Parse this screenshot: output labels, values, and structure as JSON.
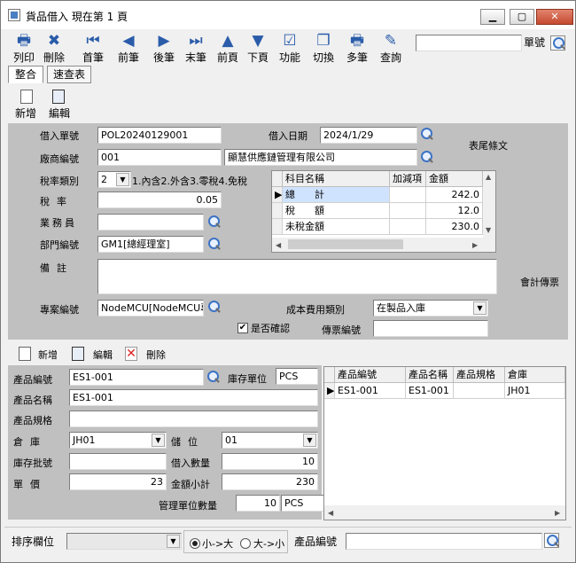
{
  "window": {
    "title": "貨品借入 現在第 1 頁"
  },
  "toolbar": {
    "items": [
      {
        "label": "列印",
        "icon": "printer-icon",
        "glyph": "🖶"
      },
      {
        "label": "刪除",
        "icon": "delete-icon",
        "glyph": "✖"
      },
      {
        "label": "首筆",
        "icon": "first-record-icon",
        "glyph": "⏮"
      },
      {
        "label": "前筆",
        "icon": "prev-record-icon",
        "glyph": "◀"
      },
      {
        "label": "後筆",
        "icon": "next-record-icon",
        "glyph": "▶"
      },
      {
        "label": "末筆",
        "icon": "last-record-icon",
        "glyph": "⏭"
      },
      {
        "label": "前頁",
        "icon": "prev-page-icon",
        "glyph": "▲"
      },
      {
        "label": "下頁",
        "icon": "next-page-icon",
        "glyph": "▼"
      },
      {
        "label": "功能",
        "icon": "function-icon",
        "glyph": "☑"
      },
      {
        "label": "切換",
        "icon": "switch-icon",
        "glyph": "❐"
      },
      {
        "label": "多筆",
        "icon": "multi-record-icon",
        "glyph": "🖶"
      },
      {
        "label": "查詢",
        "icon": "query-icon",
        "glyph": "✎"
      }
    ],
    "order_no_label": "單號",
    "order_no_value": ""
  },
  "tabs": [
    {
      "label": "整合"
    },
    {
      "label": "速查表"
    }
  ],
  "header_actions": {
    "add": "新增",
    "edit": "編輯"
  },
  "form": {
    "borrow_no_label": "借入單號",
    "borrow_no": "POL20240129001",
    "borrow_date_label": "借入日期",
    "borrow_date": "2024/1/29",
    "vendor_no_label": "廠商編號",
    "vendor_no": "001",
    "vendor_name": "顯慧供應鏈管理有限公司",
    "tax_type_label": "稅率類別",
    "tax_type": "2",
    "tax_type_desc": "1.內含2.外含3.零稅4.免稅",
    "tax_rate_label": "稅率",
    "tax_rate": "0.05",
    "salesperson_label": "業務員",
    "salesperson": "",
    "dept_no_label": "部門編號",
    "dept_no": "GM1[總經理室]",
    "note_label": "備註",
    "note": "",
    "project_no_label": "專案編號",
    "project_no": "NodeMCU[NodeMCU專案]",
    "cost_type_label": "成本費用類別",
    "cost_type": "在製品入庫",
    "confirm_label": "是否確認",
    "voucher_no_label": "傳票編號",
    "voucher_no": "",
    "footer_text_label": "表尾條文",
    "accounting_voucher_label": "會計傳票"
  },
  "summary": {
    "headers": [
      "科目名稱",
      "加減項",
      "金額"
    ],
    "rows": [
      {
        "name": "總　　計",
        "adj": "",
        "amount": "242.0"
      },
      {
        "name": "稅　　額",
        "adj": "",
        "amount": "12.0"
      },
      {
        "name": "未稅金額",
        "adj": "",
        "amount": "230.0"
      }
    ]
  },
  "detail_actions": {
    "add": "新增",
    "edit": "編輯",
    "delete": "刪除"
  },
  "detail": {
    "product_no_label": "產品編號",
    "product_no": "ES1-001",
    "stock_unit_label": "庫存單位",
    "stock_unit": "PCS",
    "product_name_label": "產品名稱",
    "product_name": "ES1-001",
    "product_spec_label": "產品規格",
    "product_spec": "",
    "warehouse_label": "倉庫",
    "warehouse": "JH01",
    "location_label": "儲位",
    "location": "01",
    "batch_no_label": "庫存批號",
    "batch_no": "",
    "borrow_qty_label": "借入數量",
    "borrow_qty": "10",
    "unit_price_label": "單價",
    "unit_price": "23",
    "subtotal_label": "金額小計",
    "subtotal": "230",
    "mgmt_qty_label": "管理單位數量",
    "mgmt_qty": "10",
    "mgmt_unit": "PCS"
  },
  "detail_grid": {
    "headers": [
      "產品編號",
      "產品名稱",
      "產品規格",
      "倉庫"
    ],
    "rows": [
      {
        "no": "ES1-001",
        "name": "ES1-001",
        "spec": "",
        "wh": "JH01"
      }
    ]
  },
  "bottom": {
    "sort_label": "排序欄位",
    "sort_value": "",
    "asc_label": "小->大",
    "desc_label": "大->小",
    "product_no_label": "產品編號",
    "product_no_value": ""
  }
}
